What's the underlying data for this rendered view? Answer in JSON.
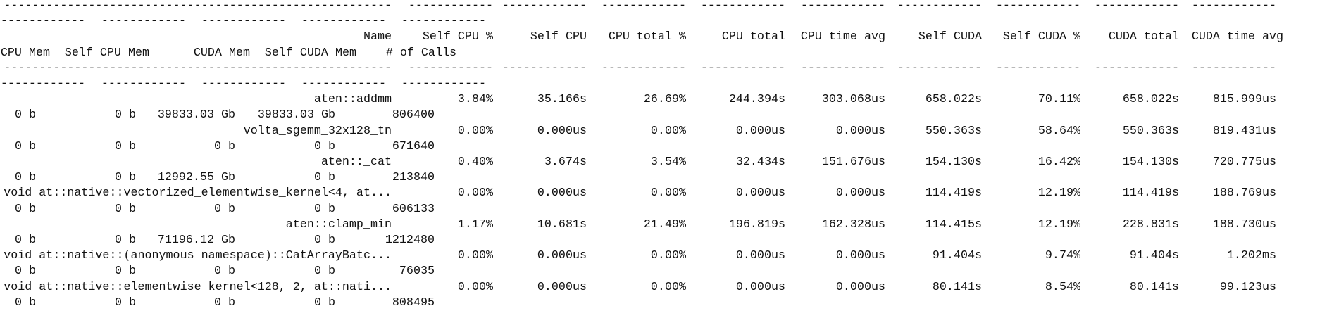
{
  "table": {
    "rule_name": "-------------------------------------------------------",
    "rule_col": "------------",
    "headers_line1": [
      "Name",
      "Self CPU %",
      "Self CPU",
      "CPU total %",
      "CPU total",
      "CPU time avg",
      "Self CUDA",
      "Self CUDA %",
      "CUDA total",
      "CUDA time avg"
    ],
    "headers_line2": [
      "CPU Mem",
      "Self CPU Mem",
      "CUDA Mem",
      "Self CUDA Mem",
      "# of Calls"
    ],
    "rows": [
      {
        "line1": [
          "aten::addmm",
          "3.84%",
          "35.166s",
          "26.69%",
          "244.394s",
          "303.068us",
          "658.022s",
          "70.11%",
          "658.022s",
          "815.999us"
        ],
        "line2": [
          "0 b",
          "0 b",
          "39833.03 Gb",
          "39833.03 Gb",
          "806400"
        ]
      },
      {
        "line1": [
          "volta_sgemm_32x128_tn",
          "0.00%",
          "0.000us",
          "0.00%",
          "0.000us",
          "0.000us",
          "550.363s",
          "58.64%",
          "550.363s",
          "819.431us"
        ],
        "line2": [
          "0 b",
          "0 b",
          "0 b",
          "0 b",
          "671640"
        ]
      },
      {
        "line1": [
          "aten::_cat",
          "0.40%",
          "3.674s",
          "3.54%",
          "32.434s",
          "151.676us",
          "154.130s",
          "16.42%",
          "154.130s",
          "720.775us"
        ],
        "line2": [
          "0 b",
          "0 b",
          "12992.55 Gb",
          "0 b",
          "213840"
        ]
      },
      {
        "line1": [
          "void at::native::vectorized_elementwise_kernel<4, at...",
          "0.00%",
          "0.000us",
          "0.00%",
          "0.000us",
          "0.000us",
          "114.419s",
          "12.19%",
          "114.419s",
          "188.769us"
        ],
        "line2": [
          "0 b",
          "0 b",
          "0 b",
          "0 b",
          "606133"
        ]
      },
      {
        "line1": [
          "aten::clamp_min",
          "1.17%",
          "10.681s",
          "21.49%",
          "196.819s",
          "162.328us",
          "114.415s",
          "12.19%",
          "228.831s",
          "188.730us"
        ],
        "line2": [
          "0 b",
          "0 b",
          "71196.12 Gb",
          "0 b",
          "1212480"
        ]
      },
      {
        "line1": [
          "void at::native::(anonymous namespace)::CatArrayBatc...",
          "0.00%",
          "0.000us",
          "0.00%",
          "0.000us",
          "0.000us",
          "91.404s",
          "9.74%",
          "91.404s",
          "1.202ms"
        ],
        "line2": [
          "0 b",
          "0 b",
          "0 b",
          "0 b",
          "76035"
        ]
      },
      {
        "line1": [
          "void at::native::elementwise_kernel<128, 2, at::nati...",
          "0.00%",
          "0.000us",
          "0.00%",
          "0.000us",
          "0.000us",
          "80.141s",
          "8.54%",
          "80.141s",
          "99.123us"
        ],
        "line2": [
          "0 b",
          "0 b",
          "0 b",
          "0 b",
          "808495"
        ]
      }
    ]
  }
}
